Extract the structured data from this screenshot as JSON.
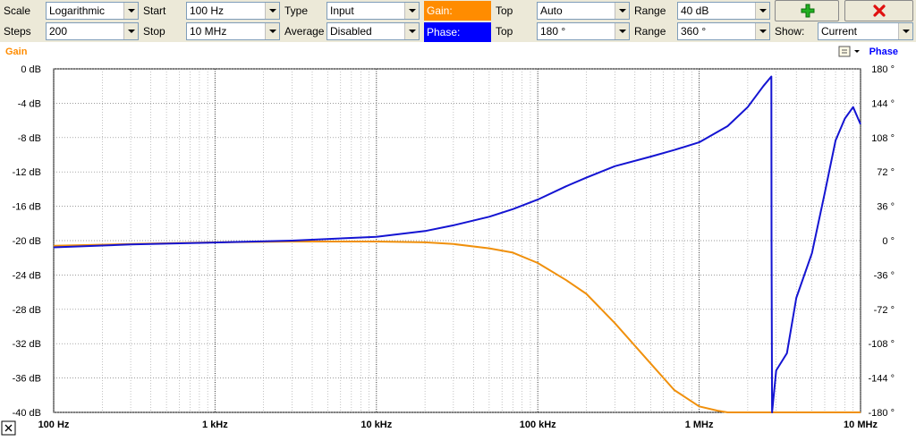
{
  "toolbar": {
    "scale_label": "Scale",
    "scale_value": "Logarithmic",
    "start_label": "Start",
    "start_value": "100 Hz",
    "type_label": "Type",
    "type_value": "Input",
    "gain_label": "Gain:",
    "top1_label": "Top",
    "top1_value": "Auto",
    "range1_label": "Range",
    "range1_value": "40 dB",
    "steps_label": "Steps",
    "steps_value": "200",
    "stop_label": "Stop",
    "stop_value": "10 MHz",
    "average_label": "Average",
    "average_value": "Disabled",
    "phase_label": "Phase:",
    "top2_label": "Top",
    "top2_value": "180 °",
    "range2_label": "Range",
    "range2_value": "360 °",
    "show_label": "Show:",
    "show_value": "Current",
    "add_icon": "green-plus-icon",
    "delete_icon": "red-x-icon",
    "gain_color": "#ff8c00",
    "phase_color": "#0000ff"
  },
  "chart_data": {
    "type": "line",
    "x_scale": "log",
    "xlim": [
      100,
      10000000
    ],
    "x_ticks": [
      "100 Hz",
      "1 kHz",
      "10 kHz",
      "100 kHz",
      "1 MHz",
      "10 MHz"
    ],
    "y_left_label": "Gain",
    "y_left_ticks": [
      "0 dB",
      "-4 dB",
      "-8 dB",
      "-12 dB",
      "-16 dB",
      "-20 dB",
      "-24 dB",
      "-28 dB",
      "-32 dB",
      "-36 dB",
      "-40 dB"
    ],
    "y_left_range": [
      -40,
      0
    ],
    "y_right_label": "Phase",
    "y_right_ticks": [
      "180 °",
      "144 °",
      "108 °",
      "72 °",
      "36 °",
      "0 °",
      "-36 °",
      "-72 °",
      "-108 °",
      "-144 °",
      "-180 °"
    ],
    "y_right_range": [
      -180,
      180
    ],
    "grid": true,
    "series": [
      {
        "name": "Gain",
        "color": "#f0900c",
        "axis": "left",
        "x": [
          100,
          300,
          1000,
          3000,
          10000,
          20000,
          30000,
          50000,
          70000,
          100000,
          150000,
          200000,
          300000,
          500000,
          700000,
          1000000,
          1300000,
          1500000,
          1700000,
          2000000,
          3000000,
          5000000,
          10000000
        ],
        "values": [
          -20.6,
          -20.4,
          -20.2,
          -20.1,
          -20.1,
          -20.2,
          -20.4,
          -20.9,
          -21.4,
          -22.6,
          -24.6,
          -26.2,
          -29.6,
          -34.3,
          -37.4,
          -39.3,
          -39.8,
          -40.0,
          -40.0,
          -40.0,
          -40.0,
          -40.0,
          -40.0
        ]
      },
      {
        "name": "Phase",
        "color": "#1414d2",
        "axis": "right",
        "x": [
          100,
          300,
          1000,
          3000,
          10000,
          20000,
          30000,
          50000,
          70000,
          100000,
          150000,
          200000,
          300000,
          500000,
          700000,
          1000000,
          1500000,
          2000000,
          2500000,
          2800000,
          2810000,
          2830000,
          3000000,
          3500000,
          4000000,
          5000000,
          6000000,
          7000000,
          8000000,
          9000000,
          10000000
        ],
        "values": [
          -7,
          -4,
          -2,
          0,
          4,
          10,
          16,
          25,
          33,
          43,
          57,
          66,
          78,
          88,
          95,
          103,
          120,
          140,
          162,
          172,
          0,
          -180,
          -136,
          -118,
          -60,
          -13,
          50,
          105,
          128,
          140,
          122
        ]
      }
    ]
  }
}
